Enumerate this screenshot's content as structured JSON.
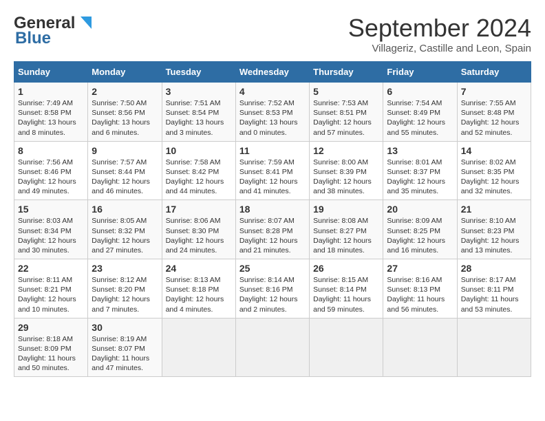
{
  "header": {
    "logo_line1": "General",
    "logo_line2": "Blue",
    "month": "September 2024",
    "location": "Villageriz, Castille and Leon, Spain"
  },
  "days_of_week": [
    "Sunday",
    "Monday",
    "Tuesday",
    "Wednesday",
    "Thursday",
    "Friday",
    "Saturday"
  ],
  "weeks": [
    [
      {
        "day": "1",
        "sunrise": "7:49 AM",
        "sunset": "8:58 PM",
        "daylight": "13 hours and 8 minutes."
      },
      {
        "day": "2",
        "sunrise": "7:50 AM",
        "sunset": "8:56 PM",
        "daylight": "13 hours and 6 minutes."
      },
      {
        "day": "3",
        "sunrise": "7:51 AM",
        "sunset": "8:54 PM",
        "daylight": "13 hours and 3 minutes."
      },
      {
        "day": "4",
        "sunrise": "7:52 AM",
        "sunset": "8:53 PM",
        "daylight": "13 hours and 0 minutes."
      },
      {
        "day": "5",
        "sunrise": "7:53 AM",
        "sunset": "8:51 PM",
        "daylight": "12 hours and 57 minutes."
      },
      {
        "day": "6",
        "sunrise": "7:54 AM",
        "sunset": "8:49 PM",
        "daylight": "12 hours and 55 minutes."
      },
      {
        "day": "7",
        "sunrise": "7:55 AM",
        "sunset": "8:48 PM",
        "daylight": "12 hours and 52 minutes."
      }
    ],
    [
      {
        "day": "8",
        "sunrise": "7:56 AM",
        "sunset": "8:46 PM",
        "daylight": "12 hours and 49 minutes."
      },
      {
        "day": "9",
        "sunrise": "7:57 AM",
        "sunset": "8:44 PM",
        "daylight": "12 hours and 46 minutes."
      },
      {
        "day": "10",
        "sunrise": "7:58 AM",
        "sunset": "8:42 PM",
        "daylight": "12 hours and 44 minutes."
      },
      {
        "day": "11",
        "sunrise": "7:59 AM",
        "sunset": "8:41 PM",
        "daylight": "12 hours and 41 minutes."
      },
      {
        "day": "12",
        "sunrise": "8:00 AM",
        "sunset": "8:39 PM",
        "daylight": "12 hours and 38 minutes."
      },
      {
        "day": "13",
        "sunrise": "8:01 AM",
        "sunset": "8:37 PM",
        "daylight": "12 hours and 35 minutes."
      },
      {
        "day": "14",
        "sunrise": "8:02 AM",
        "sunset": "8:35 PM",
        "daylight": "12 hours and 32 minutes."
      }
    ],
    [
      {
        "day": "15",
        "sunrise": "8:03 AM",
        "sunset": "8:34 PM",
        "daylight": "12 hours and 30 minutes."
      },
      {
        "day": "16",
        "sunrise": "8:05 AM",
        "sunset": "8:32 PM",
        "daylight": "12 hours and 27 minutes."
      },
      {
        "day": "17",
        "sunrise": "8:06 AM",
        "sunset": "8:30 PM",
        "daylight": "12 hours and 24 minutes."
      },
      {
        "day": "18",
        "sunrise": "8:07 AM",
        "sunset": "8:28 PM",
        "daylight": "12 hours and 21 minutes."
      },
      {
        "day": "19",
        "sunrise": "8:08 AM",
        "sunset": "8:27 PM",
        "daylight": "12 hours and 18 minutes."
      },
      {
        "day": "20",
        "sunrise": "8:09 AM",
        "sunset": "8:25 PM",
        "daylight": "12 hours and 16 minutes."
      },
      {
        "day": "21",
        "sunrise": "8:10 AM",
        "sunset": "8:23 PM",
        "daylight": "12 hours and 13 minutes."
      }
    ],
    [
      {
        "day": "22",
        "sunrise": "8:11 AM",
        "sunset": "8:21 PM",
        "daylight": "12 hours and 10 minutes."
      },
      {
        "day": "23",
        "sunrise": "8:12 AM",
        "sunset": "8:20 PM",
        "daylight": "12 hours and 7 minutes."
      },
      {
        "day": "24",
        "sunrise": "8:13 AM",
        "sunset": "8:18 PM",
        "daylight": "12 hours and 4 minutes."
      },
      {
        "day": "25",
        "sunrise": "8:14 AM",
        "sunset": "8:16 PM",
        "daylight": "12 hours and 2 minutes."
      },
      {
        "day": "26",
        "sunrise": "8:15 AM",
        "sunset": "8:14 PM",
        "daylight": "11 hours and 59 minutes."
      },
      {
        "day": "27",
        "sunrise": "8:16 AM",
        "sunset": "8:13 PM",
        "daylight": "11 hours and 56 minutes."
      },
      {
        "day": "28",
        "sunrise": "8:17 AM",
        "sunset": "8:11 PM",
        "daylight": "11 hours and 53 minutes."
      }
    ],
    [
      {
        "day": "29",
        "sunrise": "8:18 AM",
        "sunset": "8:09 PM",
        "daylight": "11 hours and 50 minutes."
      },
      {
        "day": "30",
        "sunrise": "8:19 AM",
        "sunset": "8:07 PM",
        "daylight": "11 hours and 47 minutes."
      },
      null,
      null,
      null,
      null,
      null
    ]
  ]
}
